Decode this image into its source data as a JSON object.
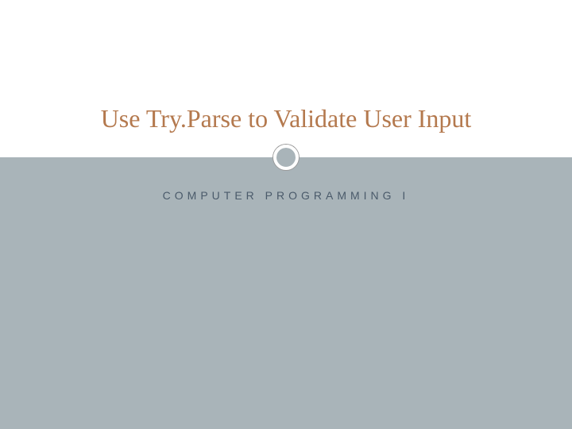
{
  "slide": {
    "title": "Use Try.Parse to Validate User Input",
    "subtitle": "COMPUTER PROGRAMMING I"
  }
}
